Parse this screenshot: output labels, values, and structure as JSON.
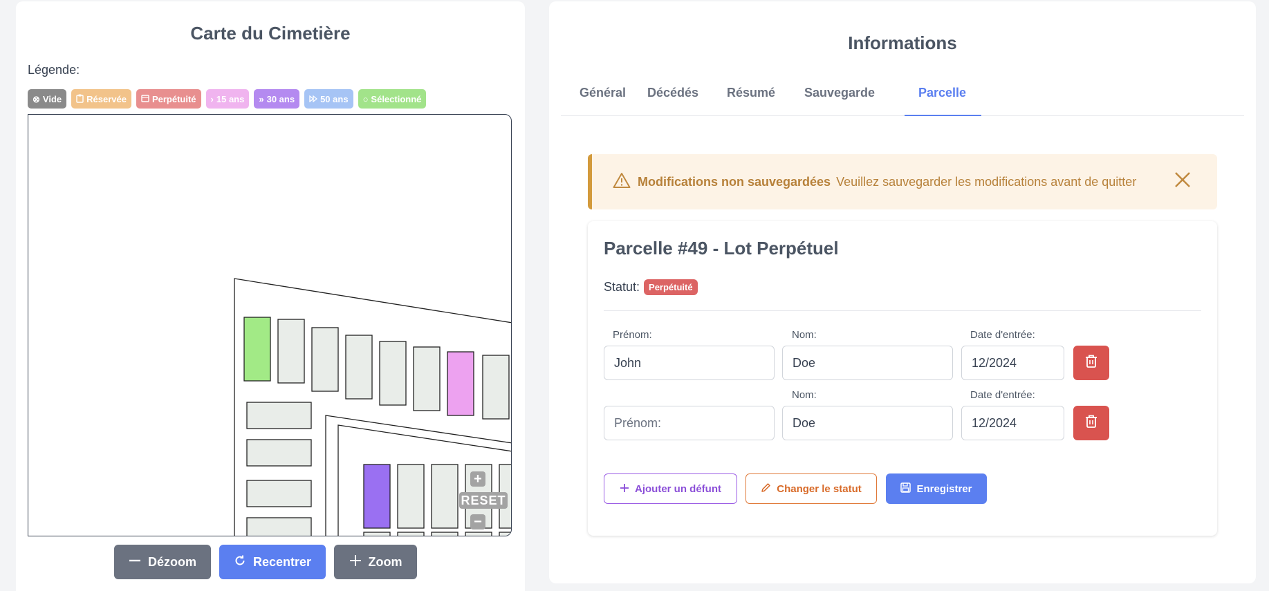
{
  "map_panel": {
    "title": "Carte du Cimetière",
    "legend_label": "Légende:",
    "legend": [
      {
        "label": "Vide",
        "icon": "⊗",
        "color": "#8a8a8a"
      },
      {
        "label": "Réservée",
        "icon": "📋",
        "color": "#f2c38a"
      },
      {
        "label": "Perpétuité",
        "icon": "▭",
        "color": "#e88f8f"
      },
      {
        "label": "15 ans",
        "icon": "›",
        "color": "#f0b4ef"
      },
      {
        "label": "30 ans",
        "icon": "»",
        "color": "#b48af0"
      },
      {
        "label": "50 ans",
        "icon": "⏩",
        "color": "#a6c4f5"
      },
      {
        "label": "Sélectionné",
        "icon": "○",
        "color": "#a2e38a"
      }
    ],
    "map_controls": {
      "zoom_in": "+",
      "reset": "RESET",
      "zoom_out": "−"
    },
    "plot_colors": {
      "empty": "#e9ede9",
      "selected": "#a2ea86",
      "fifteen_years": "#eda2f0",
      "thirty_years": "#9a70f2"
    },
    "buttons": {
      "dezoom": "Dézoom",
      "recentrer": "Recentrer",
      "zoom": "Zoom"
    }
  },
  "info_panel": {
    "title": "Informations",
    "tabs": [
      {
        "label": "Général",
        "active": false
      },
      {
        "label": "Décédés",
        "active": false
      },
      {
        "label": "Résumé",
        "active": false
      },
      {
        "label": "Sauvegarde",
        "active": false
      },
      {
        "label": "Parcelle",
        "active": true
      }
    ],
    "alert": {
      "title": "Modifications non sauvegardées",
      "message": "Veuillez sauvegarder les modifications avant de quitter"
    },
    "parcel": {
      "title": "Parcelle #49 - Lot Perpétuel",
      "status_label": "Statut:",
      "status_value": "Perpétuité",
      "rows": [
        {
          "firstname_label": "Prénom:",
          "firstname_value": "John",
          "firstname_placeholder": "Prénom:",
          "lastname_label": "Nom:",
          "lastname_value": "Doe",
          "date_label": "Date d'entrée:",
          "date_value": "12/2024"
        },
        {
          "firstname_label": "",
          "firstname_value": "",
          "firstname_placeholder": "Prénom:",
          "lastname_label": "Nom:",
          "lastname_value": "Doe",
          "date_label": "Date d'entrée:",
          "date_value": "12/2024"
        }
      ],
      "actions": {
        "add": "Ajouter un défunt",
        "change_status": "Changer le statut",
        "save": "Enregistrer"
      }
    }
  }
}
